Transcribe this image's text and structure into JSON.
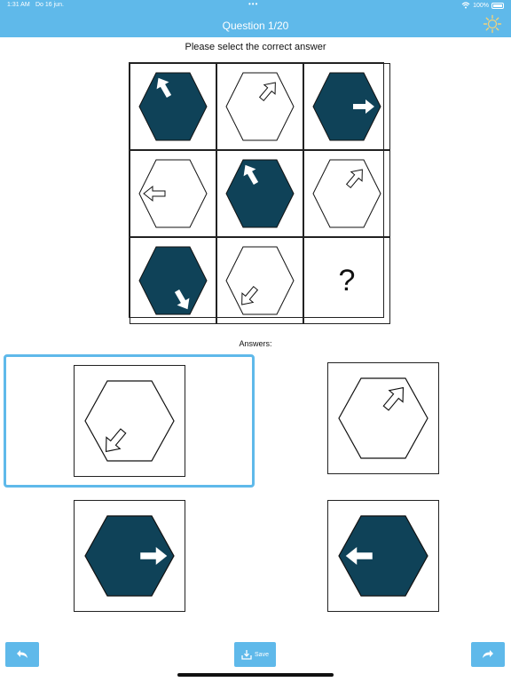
{
  "status_bar": {
    "time": "1:31 AM",
    "date": "Do 16 jun.",
    "dots": "•••",
    "battery_pct": "100%"
  },
  "header": {
    "title": "Question 1/20"
  },
  "instruction": "Please select the correct answer",
  "grid": {
    "cells": [
      {
        "hexagon": "filled",
        "arrow": "up-left",
        "arrow_style": "solid-white"
      },
      {
        "hexagon": "outline",
        "arrow": "up-right",
        "arrow_style": "outline"
      },
      {
        "hexagon": "filled",
        "arrow": "right",
        "arrow_style": "solid-white"
      },
      {
        "hexagon": "outline",
        "arrow": "left",
        "arrow_style": "outline"
      },
      {
        "hexagon": "filled",
        "arrow": "up-left",
        "arrow_style": "solid-white"
      },
      {
        "hexagon": "outline",
        "arrow": "up-right",
        "arrow_style": "outline"
      },
      {
        "hexagon": "filled",
        "arrow": "down-right",
        "arrow_style": "solid-white"
      },
      {
        "hexagon": "outline",
        "arrow": "down-left",
        "arrow_style": "outline"
      },
      {
        "question_mark": "?"
      }
    ]
  },
  "answers_label": "Answers:",
  "options": [
    {
      "hexagon": "outline",
      "arrow": "down-left",
      "selected": true
    },
    {
      "hexagon": "outline",
      "arrow": "up-right",
      "selected": false
    },
    {
      "hexagon": "filled",
      "arrow": "right",
      "selected": false
    },
    {
      "hexagon": "filled",
      "arrow": "left",
      "selected": false
    }
  ],
  "buttons": {
    "save_label": "Save"
  },
  "icons": {
    "back": "back-arrow-icon",
    "forward": "forward-arrow-icon",
    "save": "save-icon",
    "settings": "settings-icon"
  },
  "colors": {
    "accent": "#5fb9ea",
    "hex_fill": "#0f4258"
  }
}
